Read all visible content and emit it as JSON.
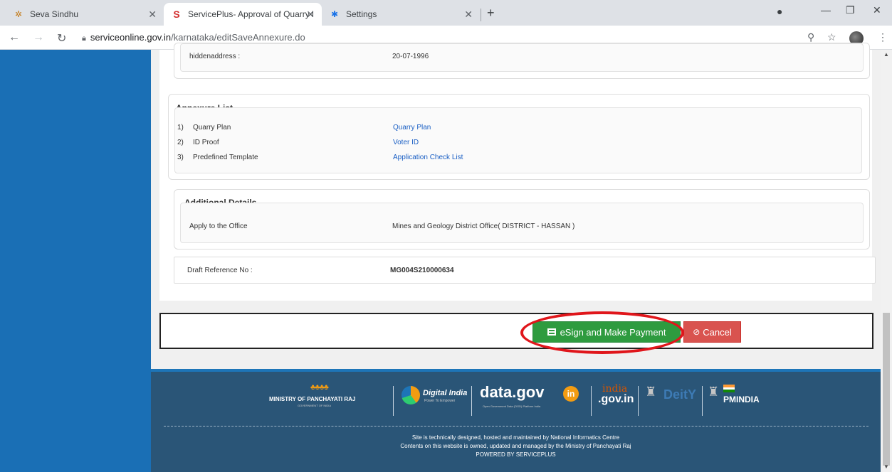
{
  "browser": {
    "tabs": [
      {
        "label": "Seva Sindhu",
        "icon": "seva-sindhu-favicon"
      },
      {
        "label": "ServicePlus- Approval of Quarry l",
        "icon": "serviceplus-favicon"
      },
      {
        "label": "Settings",
        "icon": "gear-icon"
      }
    ],
    "url_domain": "serviceonline.gov.in",
    "url_path": "/karnataka/editSaveAnnexure.do"
  },
  "form": {
    "hidden_address_label": "hiddenaddress :",
    "hidden_address_value": "20-07-1996",
    "annexure": {
      "title": "Annexure List",
      "items": [
        {
          "num": "1)",
          "label": "Quarry Plan",
          "link": "Quarry Plan"
        },
        {
          "num": "2)",
          "label": "ID Proof",
          "link": "Voter ID"
        },
        {
          "num": "3)",
          "label": "Predefined Template",
          "link": "Application Check List"
        }
      ]
    },
    "additional": {
      "title": "Additional Details",
      "office_label": "Apply to the Office",
      "office_value": "Mines and Geology District Office( DISTRICT - HASSAN )"
    },
    "draft_label": "Draft Reference No :",
    "draft_value": "MG004S210000634"
  },
  "actions": {
    "esign_label": "eSign and Make Payment",
    "cancel_label": "Cancel"
  },
  "footer": {
    "logos": {
      "panchayati": "MINISTRY OF PANCHAYATI RAJ",
      "panchayati_sub": "GOVERNMENT OF INDIA",
      "digital_india": "Digital India",
      "digital_india_sub": "Power To Empower",
      "datagov": "data.gov",
      "datagov_badge": "in",
      "datagov_sub": "Open Government Data (OGD) Platform India",
      "indiagov_top": "india",
      "indiagov_bottom": ".gov.in",
      "deity": "DeitY",
      "pmindia": "PMINDIA"
    },
    "line1": "Site is technically designed, hosted and maintained by National Informatics Centre",
    "line2": "Contents on this website is owned, updated and managed by the Ministry of Panchayati Raj",
    "line3": "POWERED BY SERVICEPLUS"
  },
  "colors": {
    "sidebar": "#1a6fb5",
    "esign_button": "#2e9b3f",
    "cancel_button": "#d9534f",
    "highlight_ellipse": "#e0161b",
    "footer_bg": "#2a5577"
  }
}
